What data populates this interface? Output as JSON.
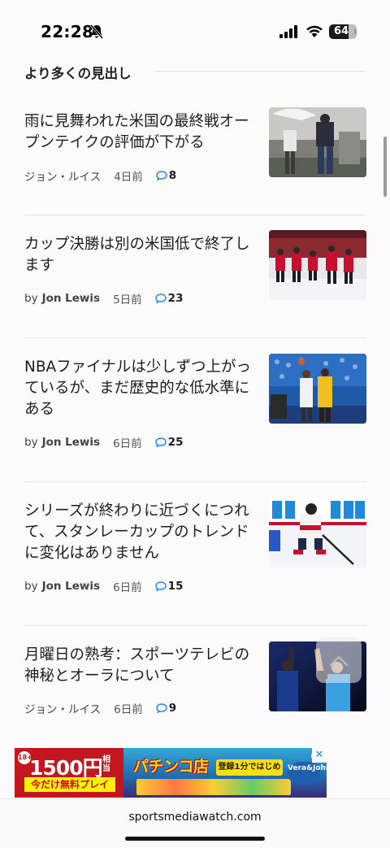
{
  "status_bar": {
    "time": "22:28",
    "battery": "64"
  },
  "section": {
    "title": "より多くの見出し"
  },
  "articles": [
    {
      "headline": "雨に見舞われた米国の最終戦オープンテイクの評価が下がる",
      "author_by": "",
      "author": "ジョン・ルイス",
      "date": "4日前",
      "comments": "8",
      "image_icon": "golf-photo"
    },
    {
      "headline": "カップ決勝は別の米国低で終了します",
      "author_by": "by",
      "author": "Jon Lewis",
      "date": "5日前",
      "comments": "23",
      "image_icon": "hockey-celebration-photo"
    },
    {
      "headline": "NBAファイナルは少しずつ上がっているが、まだ歴史的な低水準にある",
      "author_by": "by",
      "author": "Jon Lewis",
      "date": "6日前",
      "comments": "25",
      "image_icon": "basketball-photo"
    },
    {
      "headline": "シリーズが終わりに近づくにつれて、スタンレーカップのトレンドに変化はありません",
      "author_by": "by",
      "author": "Jon Lewis",
      "date": "6日前",
      "comments": "15",
      "image_icon": "hockey-player-photo"
    },
    {
      "headline": "月曜日の熟考：スポーツテレビの神秘とオーラについて",
      "author_by": "",
      "author": "ジョン・ルイス",
      "date": "6日前",
      "comments": "9",
      "image_icon": "broadcast-photo"
    }
  ],
  "ad": {
    "age": "18+",
    "price": "1500円",
    "price_sub": "相当",
    "free_play": "今だけ無料プレイ",
    "logo": "パチンコ店",
    "cta": "登録1分ではじめる",
    "brand": "Vera&John",
    "info": "i",
    "close": "✕"
  },
  "url_bar": {
    "domain": "sportsmediawatch.com"
  },
  "colors": {
    "accent": "#1e88e5",
    "background": "#fbfbfb",
    "ad_red": "#c3161f"
  }
}
